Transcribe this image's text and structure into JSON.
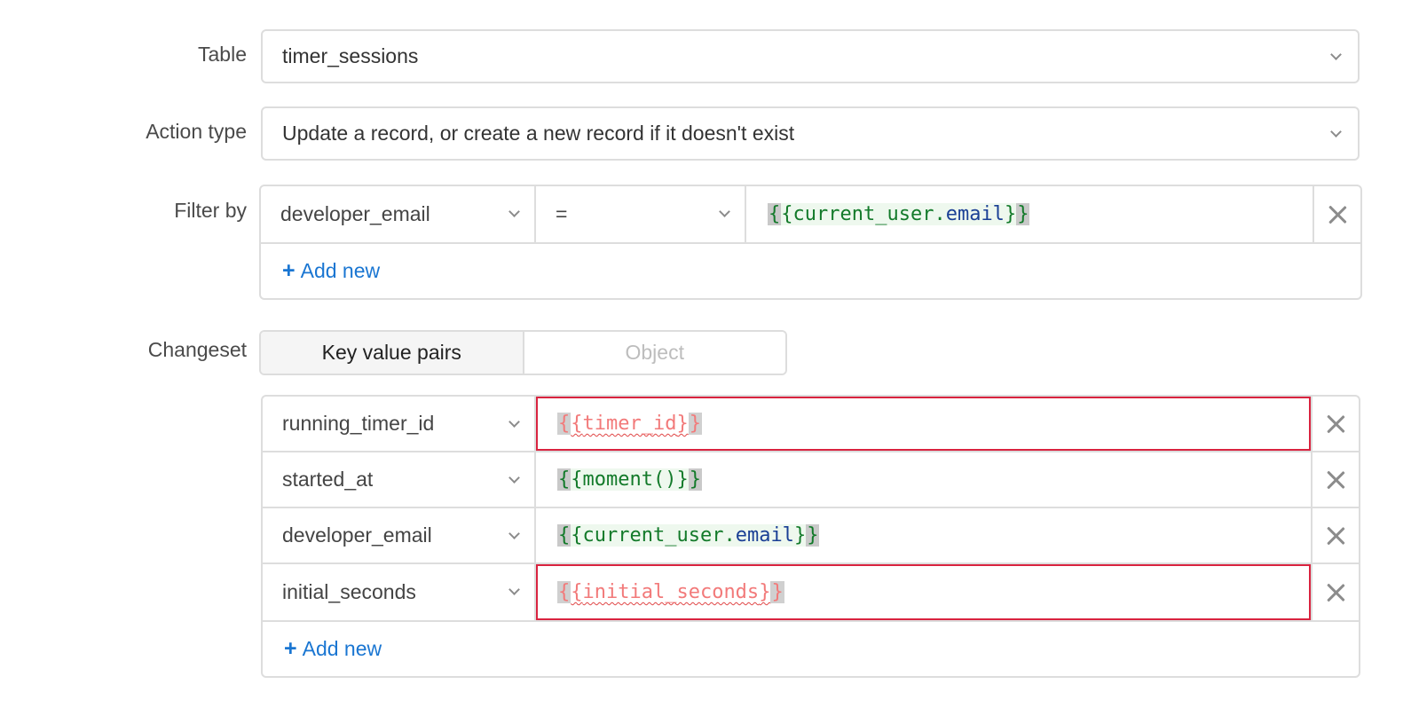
{
  "form": {
    "table": {
      "label": "Table",
      "value": "timer_sessions"
    },
    "action_type": {
      "label": "Action type",
      "value": "Update a record, or create a new record if it doesn't exist"
    },
    "filter_by": {
      "label": "Filter by",
      "rows": [
        {
          "column": "developer_email",
          "operator": "=",
          "value_object": "current_user",
          "value_property": "email"
        }
      ],
      "add_new_label": "Add new"
    },
    "changeset": {
      "label": "Changeset",
      "modes": [
        "Key value pairs",
        "Object"
      ],
      "active_mode": "Key value pairs",
      "rows": [
        {
          "key": "running_timer_id",
          "value": "timer_id",
          "error": true
        },
        {
          "key": "started_at",
          "value": "moment()",
          "error": false
        },
        {
          "key": "developer_email",
          "value_object": "current_user",
          "value_property": "email",
          "error": false
        },
        {
          "key": "initial_seconds",
          "value": "initial_seconds",
          "error": true
        }
      ],
      "add_new_label": "Add new"
    }
  },
  "colors": {
    "accent": "#1a76d2",
    "error": "#d9233f",
    "expr_green": "#137a2a",
    "expr_prop": "#1a3f95"
  },
  "icons": {
    "chevron": "chevron-down-icon",
    "remove": "close-icon",
    "add": "plus-icon"
  }
}
